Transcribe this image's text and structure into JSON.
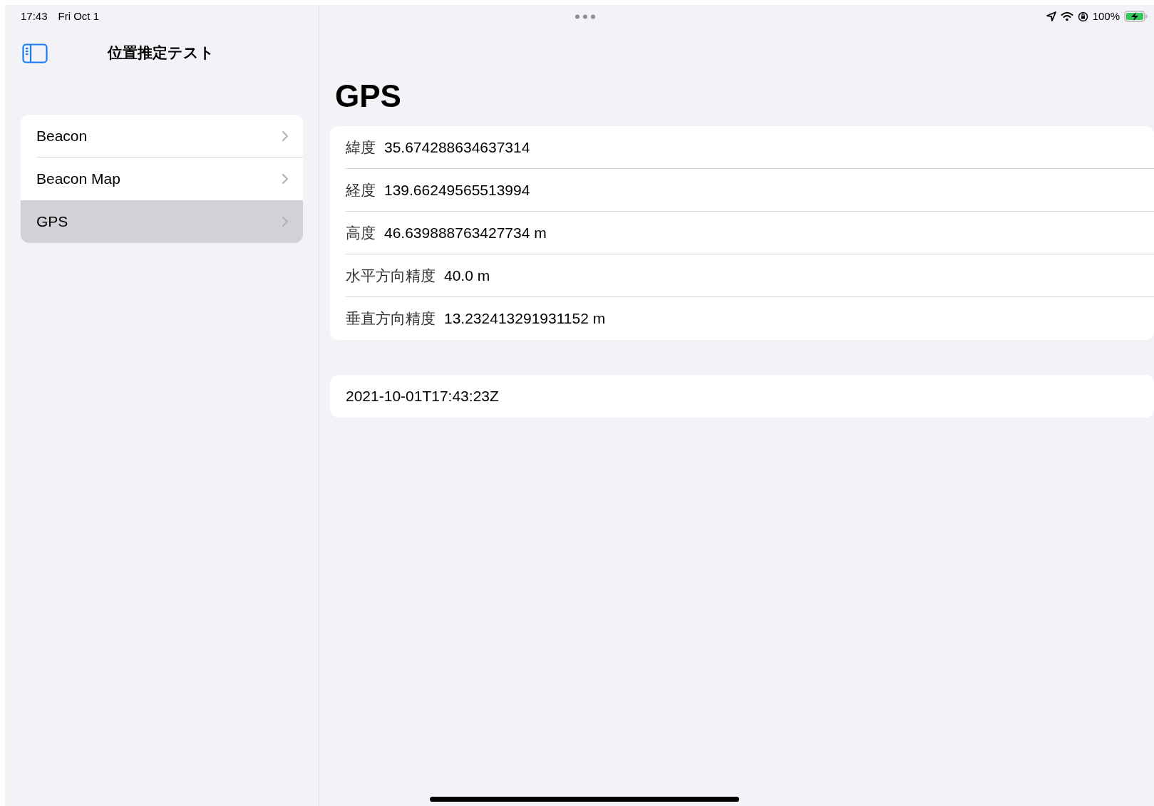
{
  "status_bar": {
    "time": "17:43",
    "date": "Fri Oct 1",
    "battery": "100%",
    "charging": true
  },
  "sidebar": {
    "title": "位置推定テスト",
    "items": [
      {
        "label": "Beacon",
        "selected": false
      },
      {
        "label": "Beacon Map",
        "selected": false
      },
      {
        "label": "GPS",
        "selected": true
      }
    ]
  },
  "detail": {
    "title": "GPS",
    "rows": [
      {
        "label": "緯度",
        "value": "35.674288634637314"
      },
      {
        "label": "経度",
        "value": "139.66249565513994"
      },
      {
        "label": "高度",
        "value": "46.639888763427734 m"
      },
      {
        "label": "水平方向精度",
        "value": "40.0 m"
      },
      {
        "label": "垂直方向精度",
        "value": "13.232413291931152 m"
      }
    ],
    "timestamp": "2021-10-01T17:43:23Z"
  }
}
